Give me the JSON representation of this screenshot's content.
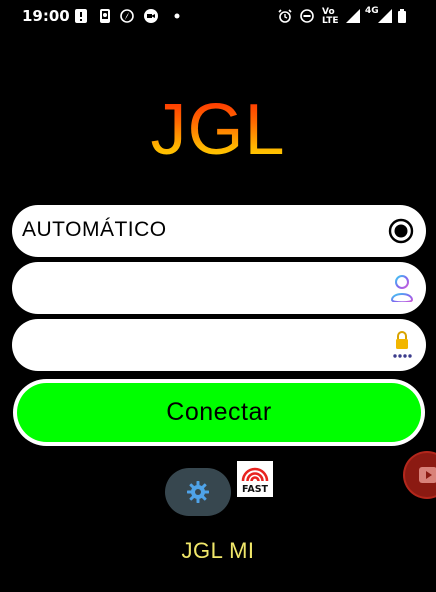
{
  "status_bar": {
    "time": "19:00",
    "volte_line1": "Vo",
    "volte_line2": "LTE",
    "network": "4G"
  },
  "app": {
    "logo": "JGL"
  },
  "form": {
    "mode_value": "AUTOMÁTICO",
    "username_value": "",
    "password_value": ""
  },
  "connect": {
    "label": "Conectar"
  },
  "footer": {
    "label": "JGL MI"
  },
  "colors": {
    "background": "#000000",
    "connect_green": "#00ff00",
    "footer_yellow": "#f0e76a",
    "settings_bg": "#37474f"
  },
  "icons": {
    "mode": "radio-selected-icon",
    "username": "user-profile-icon",
    "password": "lock-dots-icon",
    "settings": "gear-icon",
    "speedtest": "fast-speedtest-icon",
    "floating": "youtube-icon"
  }
}
